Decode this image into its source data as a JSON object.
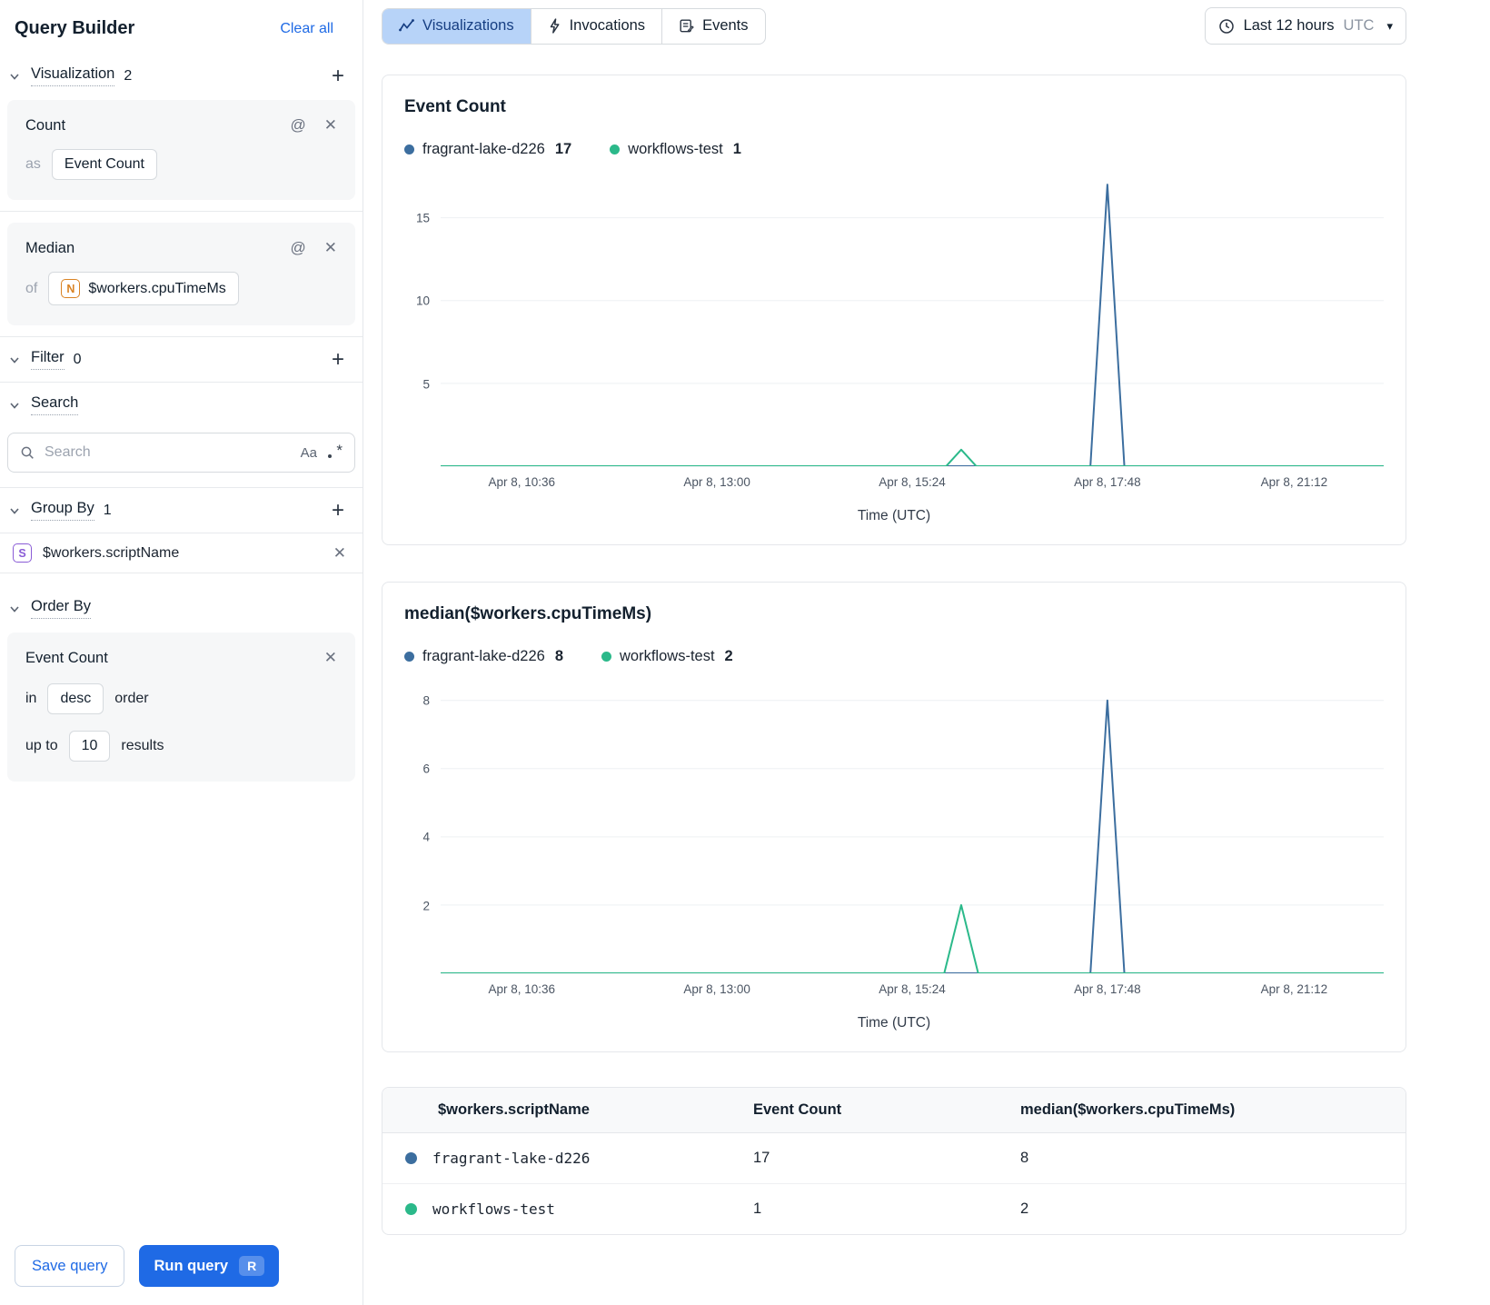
{
  "icons": {
    "at": "@",
    "close": "✕",
    "plus": "+",
    "caret_down": "▾",
    "match_case": "Aa"
  },
  "colors": {
    "accent_blue": "#1f6ae5",
    "tab_selected_bg": "#b7d3f8",
    "series_blue": "#3c6e9f",
    "series_green": "#2bb98a"
  },
  "sidebar": {
    "title": "Query Builder",
    "clear_all": "Clear all",
    "visualization": {
      "label": "Visualization",
      "count": "2"
    },
    "viz_cards": [
      {
        "title": "Count",
        "prefix": "as",
        "chip": "Event Count"
      },
      {
        "title": "Median",
        "prefix": "of",
        "chip_icon": "N",
        "chip": "$workers.cpuTimeMs"
      }
    ],
    "filter": {
      "label": "Filter",
      "count": "0"
    },
    "search": {
      "label": "Search",
      "placeholder": "Search"
    },
    "group_by": {
      "label": "Group By",
      "count": "1",
      "item_icon": "S",
      "item": "$workers.scriptName"
    },
    "order_by": {
      "label": "Order By",
      "card_title": "Event Count",
      "in_label": "in",
      "direction": "desc",
      "order_label": "order",
      "up_to_label": "up to",
      "limit": "10",
      "results_label": "results"
    },
    "save_label": "Save query",
    "run_label": "Run query",
    "run_key": "R"
  },
  "tabs": [
    {
      "label": "Visualizations"
    },
    {
      "label": "Invocations"
    },
    {
      "label": "Events"
    }
  ],
  "time_range": {
    "label": "Last 12 hours",
    "tz": "UTC"
  },
  "table": {
    "headers": [
      "$workers.scriptName",
      "Event Count",
      "median($workers.cpuTimeMs)"
    ],
    "rows": [
      {
        "color": "#3c6e9f",
        "name": "fragrant-lake-d226",
        "event_count": "17",
        "median": "8"
      },
      {
        "color": "#2bb98a",
        "name": "workflows-test",
        "event_count": "1",
        "median": "2"
      }
    ]
  },
  "chart_data": [
    {
      "type": "line",
      "title": "Event Count",
      "xlabel": "Time (UTC)",
      "ylim": [
        0,
        17.5
      ],
      "yticks": [
        5,
        10,
        15
      ],
      "xticks": [
        {
          "frac": 0.086,
          "label": "Apr 8, 10:36"
        },
        {
          "frac": 0.293,
          "label": "Apr 8, 13:00"
        },
        {
          "frac": 0.5,
          "label": "Apr 8, 15:24"
        },
        {
          "frac": 0.707,
          "label": "Apr 8, 17:48"
        },
        {
          "frac": 0.905,
          "label": "Apr 8, 21:12"
        }
      ],
      "series": [
        {
          "name": "fragrant-lake-d226",
          "legend_value": "17",
          "color": "#3c6e9f",
          "points": [
            [
              0,
              0
            ],
            [
              0.689,
              0
            ],
            [
              0.707,
              17
            ],
            [
              0.725,
              0
            ],
            [
              1,
              0
            ]
          ]
        },
        {
          "name": "workflows-test",
          "legend_value": "1",
          "color": "#2bb98a",
          "points": [
            [
              0,
              0
            ],
            [
              0.536,
              0
            ],
            [
              0.552,
              1
            ],
            [
              0.568,
              0
            ],
            [
              1,
              0
            ]
          ]
        }
      ]
    },
    {
      "type": "line",
      "title": "median($workers.cpuTimeMs)",
      "xlabel": "Time (UTC)",
      "ylim": [
        0,
        8.5
      ],
      "yticks": [
        2,
        4,
        6,
        8
      ],
      "xticks": [
        {
          "frac": 0.086,
          "label": "Apr 8, 10:36"
        },
        {
          "frac": 0.293,
          "label": "Apr 8, 13:00"
        },
        {
          "frac": 0.5,
          "label": "Apr 8, 15:24"
        },
        {
          "frac": 0.707,
          "label": "Apr 8, 17:48"
        },
        {
          "frac": 0.905,
          "label": "Apr 8, 21:12"
        }
      ],
      "series": [
        {
          "name": "fragrant-lake-d226",
          "legend_value": "8",
          "color": "#3c6e9f",
          "points": [
            [
              0,
              0
            ],
            [
              0.689,
              0
            ],
            [
              0.707,
              8
            ],
            [
              0.725,
              0
            ],
            [
              1,
              0
            ]
          ]
        },
        {
          "name": "workflows-test",
          "legend_value": "2",
          "color": "#2bb98a",
          "points": [
            [
              0,
              0
            ],
            [
              0.534,
              0
            ],
            [
              0.552,
              2
            ],
            [
              0.57,
              0
            ],
            [
              1,
              0
            ]
          ]
        }
      ]
    }
  ]
}
